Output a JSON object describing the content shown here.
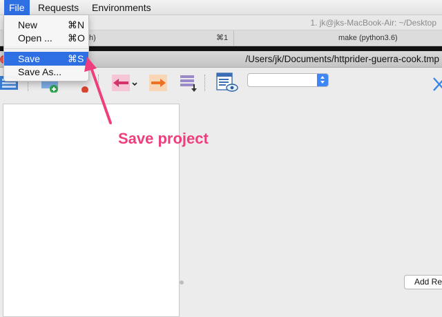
{
  "menubar": {
    "file": "File",
    "requests": "Requests",
    "environments": "Environments"
  },
  "terminal": {
    "title": "1. jk@jks-MacBook-Air: ~/Desktop",
    "tab1_label": "zsh)",
    "tab1_shortcut": "⌘1",
    "tab2_label": "make (python3.6)"
  },
  "window": {
    "path": "/Users/jk/Documents/httprider-guerra-cook.tmp"
  },
  "file_menu": {
    "items": [
      {
        "label": "New",
        "shortcut": "⌘N"
      },
      {
        "label": "Open ...",
        "shortcut": "⌘O"
      },
      {
        "label": "Save",
        "shortcut": "⌘S"
      },
      {
        "label": "Save As..."
      }
    ]
  },
  "toolbar": {
    "environment_select_value": ""
  },
  "main": {
    "add_request_label": "Add Re"
  },
  "annotation": {
    "text": "Save project",
    "color": "#ef3e7d"
  },
  "colors": {
    "menu_highlight": "#2f6fe4",
    "accent_pink": "#ef3e7d"
  }
}
